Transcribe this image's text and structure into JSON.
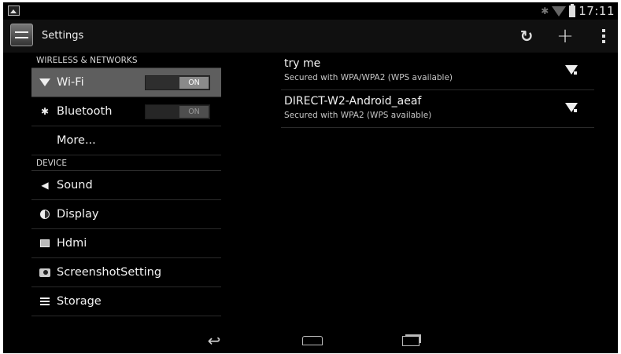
{
  "status_bar": {
    "time": "17:11",
    "icons": [
      "gallery-icon",
      "bluetooth-icon",
      "wifi-signal-icon",
      "battery-icon"
    ]
  },
  "action_bar": {
    "title": "Settings",
    "refresh_glyph": "↻",
    "add_glyph": "+"
  },
  "left_panel": {
    "sections": {
      "wireless": "WIRELESS & NETWORKS",
      "device": "DEVICE"
    },
    "wireless_items": [
      {
        "label": "Wi-Fi",
        "toggle": "ON",
        "icon": "wifi-icon",
        "selected": true
      },
      {
        "label": "Bluetooth",
        "toggle": "ON",
        "icon": "bluetooth-icon",
        "selected": false
      },
      {
        "label": "More...",
        "icon": "",
        "selected": false
      }
    ],
    "device_items": [
      {
        "label": "Sound",
        "icon": "sound-icon"
      },
      {
        "label": "Display",
        "icon": "display-icon"
      },
      {
        "label": "Hdmi",
        "icon": "hdmi-icon"
      },
      {
        "label": "ScreenshotSetting",
        "icon": "camera-icon"
      },
      {
        "label": "Storage",
        "icon": "storage-icon"
      }
    ]
  },
  "networks": [
    {
      "ssid": "try me",
      "security": "Secured with WPA/WPA2 (WPS available)"
    },
    {
      "ssid": "DIRECT-W2-Android_aeaf",
      "security": "Secured with WPA2 (WPS available)"
    }
  ],
  "nav_bar": {
    "back_glyph": "↩"
  }
}
